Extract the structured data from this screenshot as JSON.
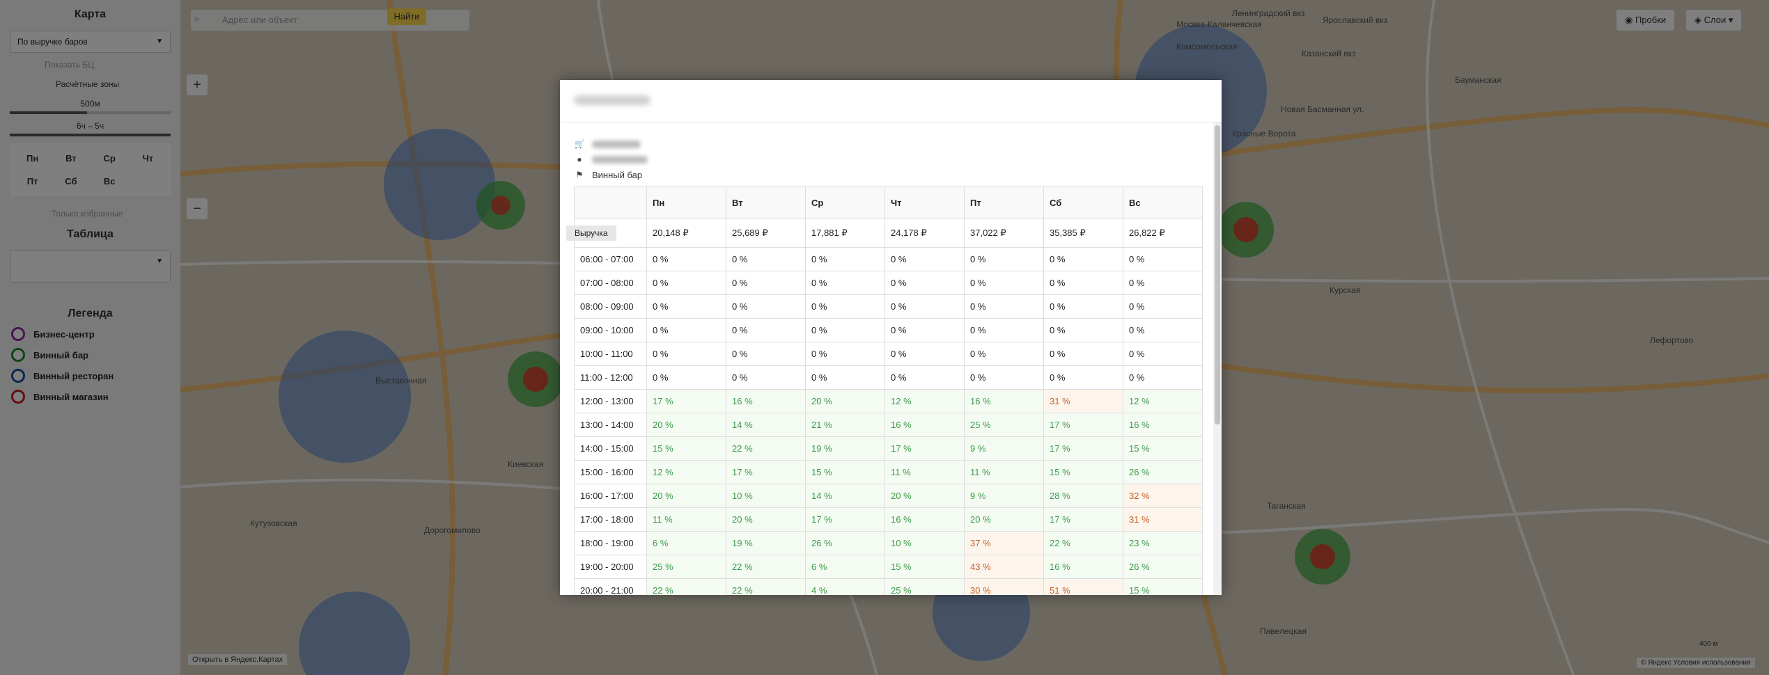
{
  "sidebar": {
    "map_title": "Карта",
    "mode_select": "По выручке баров",
    "show_toggle": "Показать БЦ",
    "zones_toggle": "Расчётные зоны",
    "radius": "500м",
    "time_range": "6ч – 5ч",
    "days": [
      "Пн",
      "Вт",
      "Ср",
      "Чт",
      "Пт",
      "Сб",
      "Вс"
    ],
    "only_favorites": "Только избранные",
    "table_title": "Таблица",
    "legend_title": "Легенда",
    "legend": [
      {
        "label": "Бизнес-центр",
        "color": "#8e2aa1"
      },
      {
        "label": "Винный бар",
        "color": "#1e8a2e"
      },
      {
        "label": "Винный ресторан",
        "color": "#1c4fa0"
      },
      {
        "label": "Винный магазин",
        "color": "#c41e2a"
      }
    ]
  },
  "toolbar": {
    "search_placeholder": "Адрес или объект",
    "find_button": "Найти",
    "traffic_button": "Пробки",
    "layers_button": "Слои",
    "open_in_yandex": "Открыть в Яндекс.Картах",
    "yandex_copyright": "© Яндекс Условия использования",
    "scale": "400 м"
  },
  "map_labels": [
    "Ленинградский вкз",
    "Ярославский вкз",
    "Казанский вкз",
    "Комсомольская",
    "Красные Ворота",
    "Курская",
    "Таганская",
    "Павелецкая",
    "Киевская",
    "Кутузовская",
    "Выставочная",
    "Дорогомилово",
    "Бауманская",
    "Лефортово",
    "Москва-Каланчевская",
    "Новая Басманная ул."
  ],
  "modal": {
    "category": "Винный бар",
    "revenue_label": "Выручка",
    "columns": [
      "Пн",
      "Вт",
      "Ср",
      "Чт",
      "Пт",
      "Сб",
      "Вс"
    ],
    "revenue": [
      "20,148 ₽",
      "25,689 ₽",
      "17,881 ₽",
      "24,178 ₽",
      "37,022 ₽",
      "35,385 ₽",
      "26,822 ₽"
    ],
    "rows": [
      {
        "time": "06:00 - 07:00",
        "values": [
          "0 %",
          "0 %",
          "0 %",
          "0 %",
          "0 %",
          "0 %",
          "0 %"
        ]
      },
      {
        "time": "07:00 - 08:00",
        "values": [
          "0 %",
          "0 %",
          "0 %",
          "0 %",
          "0 %",
          "0 %",
          "0 %"
        ]
      },
      {
        "time": "08:00 - 09:00",
        "values": [
          "0 %",
          "0 %",
          "0 %",
          "0 %",
          "0 %",
          "0 %",
          "0 %"
        ]
      },
      {
        "time": "09:00 - 10:00",
        "values": [
          "0 %",
          "0 %",
          "0 %",
          "0 %",
          "0 %",
          "0 %",
          "0 %"
        ]
      },
      {
        "time": "10:00 - 11:00",
        "values": [
          "0 %",
          "0 %",
          "0 %",
          "0 %",
          "0 %",
          "0 %",
          "0 %"
        ]
      },
      {
        "time": "11:00 - 12:00",
        "values": [
          "0 %",
          "0 %",
          "0 %",
          "0 %",
          "0 %",
          "0 %",
          "0 %"
        ]
      },
      {
        "time": "12:00 - 13:00",
        "values": [
          "17 %",
          "16 %",
          "20 %",
          "12 %",
          "16 %",
          "31 %",
          "12 %"
        ]
      },
      {
        "time": "13:00 - 14:00",
        "values": [
          "20 %",
          "14 %",
          "21 %",
          "16 %",
          "25 %",
          "17 %",
          "16 %"
        ]
      },
      {
        "time": "14:00 - 15:00",
        "values": [
          "15 %",
          "22 %",
          "19 %",
          "17 %",
          "9 %",
          "17 %",
          "15 %"
        ]
      },
      {
        "time": "15:00 - 16:00",
        "values": [
          "12 %",
          "17 %",
          "15 %",
          "11 %",
          "11 %",
          "15 %",
          "26 %"
        ]
      },
      {
        "time": "16:00 - 17:00",
        "values": [
          "20 %",
          "10 %",
          "14 %",
          "20 %",
          "9 %",
          "28 %",
          "32 %"
        ]
      },
      {
        "time": "17:00 - 18:00",
        "values": [
          "11 %",
          "20 %",
          "17 %",
          "16 %",
          "20 %",
          "17 %",
          "31 %"
        ]
      },
      {
        "time": "18:00 - 19:00",
        "values": [
          "6 %",
          "19 %",
          "26 %",
          "10 %",
          "37 %",
          "22 %",
          "23 %"
        ]
      },
      {
        "time": "19:00 - 20:00",
        "values": [
          "25 %",
          "22 %",
          "6 %",
          "15 %",
          "43 %",
          "16 %",
          "26 %"
        ]
      },
      {
        "time": "20:00 - 21:00",
        "values": [
          "22 %",
          "22 %",
          "4 %",
          "25 %",
          "30 %",
          "51 %",
          "15 %"
        ]
      }
    ]
  }
}
